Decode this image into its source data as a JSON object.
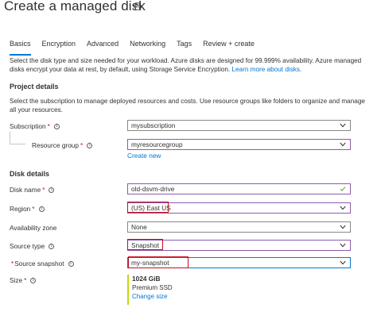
{
  "page": {
    "title": "Create a managed disk"
  },
  "icons": {
    "print": "print-icon",
    "info": "info-icon",
    "chevron": "chevron-down-icon",
    "check": "checkmark-icon"
  },
  "colors": {
    "accent": "#0078d4",
    "required": "#a4262c",
    "highlight_box": "#c50f1f",
    "field_border_edited": "#8e5aa8",
    "size_bar": "#c6d60e"
  },
  "tabs": [
    {
      "label": "Basics",
      "active": true
    },
    {
      "label": "Encryption",
      "active": false
    },
    {
      "label": "Advanced",
      "active": false
    },
    {
      "label": "Networking",
      "active": false
    },
    {
      "label": "Tags",
      "active": false
    },
    {
      "label": "Review + create",
      "active": false
    }
  ],
  "intro": {
    "text": "Select the disk type and size needed for your workload. Azure disks are designed for 99.999% availability. Azure managed disks encrypt your data at rest, by default, using Storage Service Encryption.",
    "link": "Learn more about disks."
  },
  "project": {
    "heading": "Project details",
    "description": "Select the subscription to manage deployed resources and costs. Use resource groups like folders to organize and manage all your resources.",
    "subscription": {
      "label": "Subscription",
      "required": "*",
      "value": "mysubscription"
    },
    "resource_group": {
      "label": "Resource group",
      "required": "*",
      "value": "myresourcegroup",
      "create_link": "Create new"
    }
  },
  "disk": {
    "heading": "Disk details",
    "disk_name": {
      "label": "Disk name",
      "required": "*",
      "value": "old-dsvm-drive"
    },
    "region": {
      "label": "Region",
      "required": "*",
      "value": "(US) East US"
    },
    "availability_zone": {
      "label": "Availability zone",
      "value": "None"
    },
    "source_type": {
      "label": "Source type",
      "value": "Snapshot"
    },
    "source_snapshot": {
      "label": "Source snapshot",
      "required": "*",
      "value": "my-snapshot"
    },
    "size": {
      "label": "Size",
      "required": "*",
      "value": "1024 GiB",
      "tier": "Premium SSD",
      "change_link": "Change size"
    }
  }
}
